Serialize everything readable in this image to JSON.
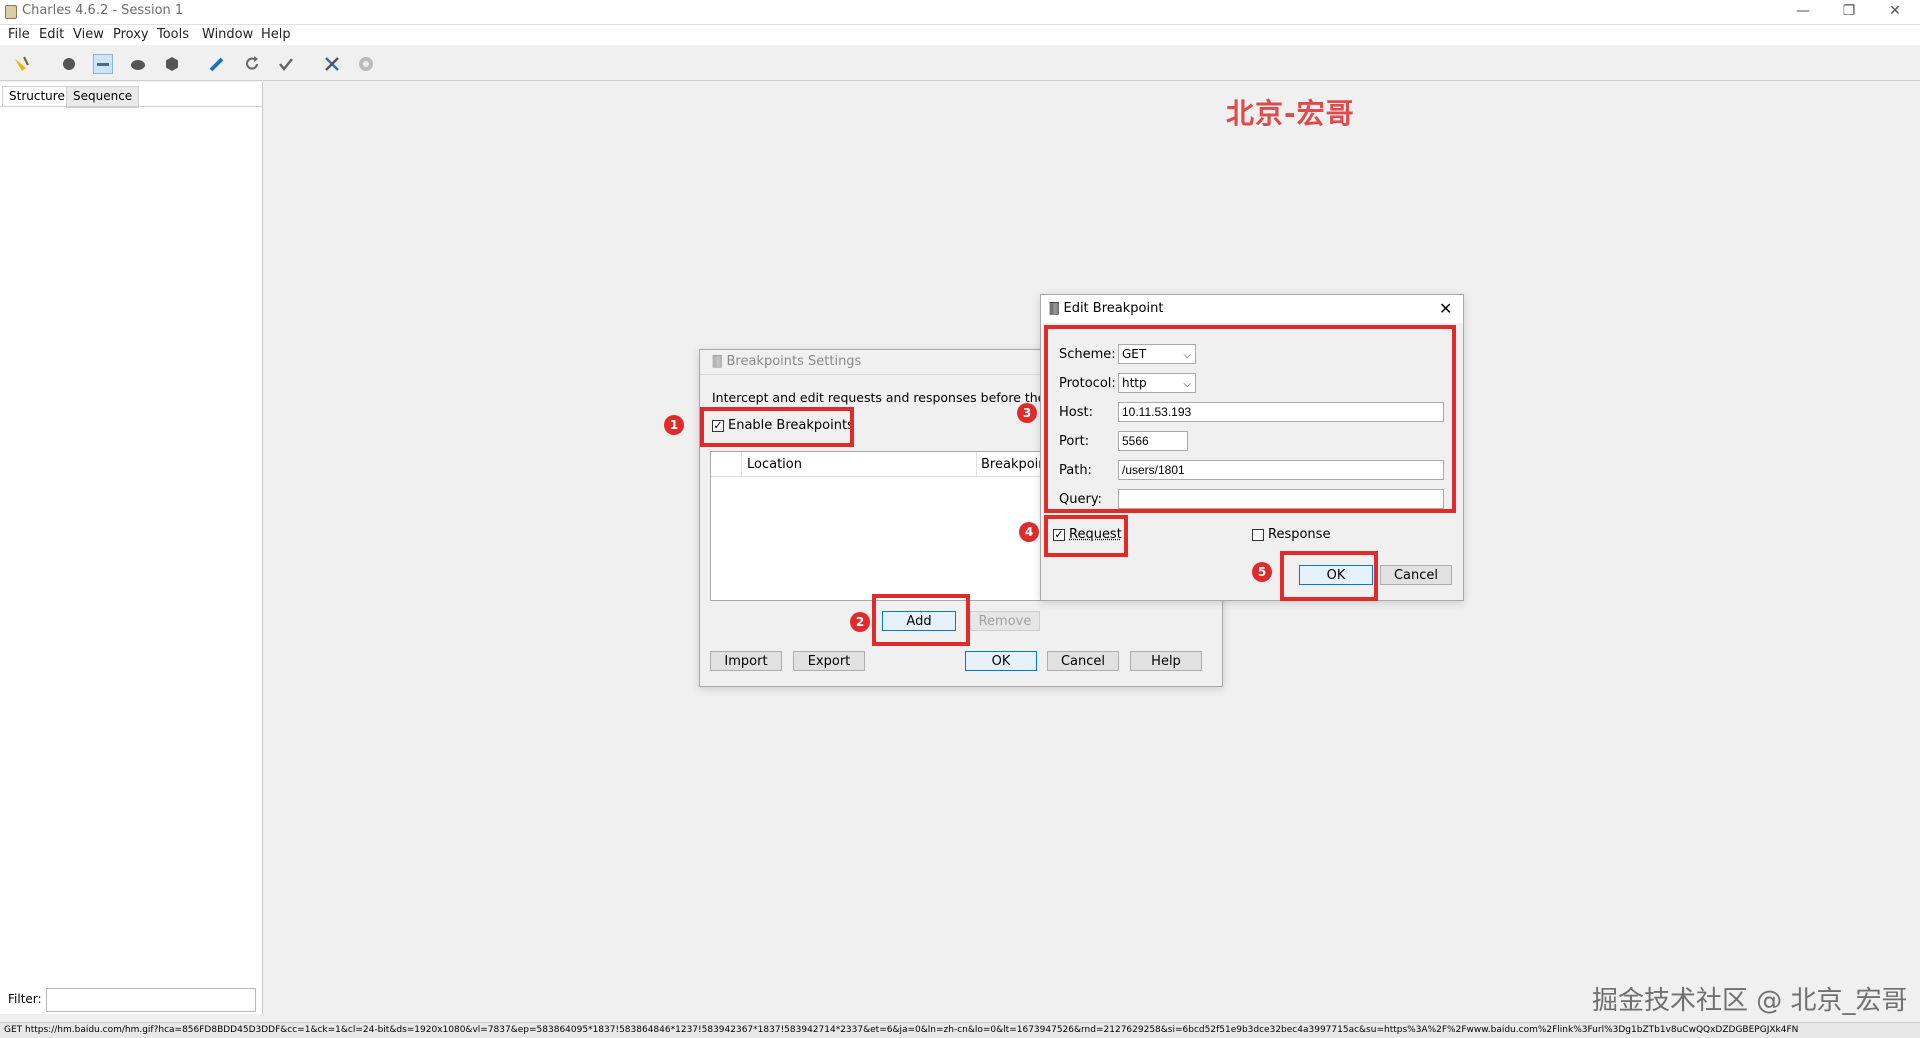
{
  "window": {
    "title": "Charles 4.6.2 - Session 1",
    "minimize": "—",
    "restore": "❐",
    "close": "✕"
  },
  "menu": [
    "File",
    "Edit",
    "View",
    "Proxy",
    "Tools",
    "Window",
    "Help"
  ],
  "toolbar_icons": [
    "broom-icon",
    "record-icon",
    "throttle-icon",
    "turtle-icon",
    "breakpoint-hexagon-icon",
    "pen-icon",
    "refresh-icon",
    "check-icon",
    "tools-icon",
    "settings-gear-icon"
  ],
  "left_panel": {
    "tabs": [
      "Structure",
      "Sequence"
    ],
    "filter_label": "Filter:",
    "filter_value": ""
  },
  "watermarks": {
    "top": "北京-宏哥",
    "bottom": "掘金技术社区 @ 北京_宏哥"
  },
  "status_bar": "GET https://hm.baidu.com/hm.gif?hca=856FD8BDD45D3DDF&cc=1&ck=1&cl=24-bit&ds=1920x1080&vl=7837&ep=583864095*1837!583864846*1237!583942367*1837!583942714*2337&et=6&ja=0&ln=zh-cn&lo=0&lt=1673947526&rnd=2127629258&si=6bcd52f51e9b3dce32bec4a3997715ac&su=https%3A%2F%2Fwww.baidu.com%2Flink%3Furl%3Dg1bZTb1v8uCwQQxDZDGBEPGJXk4FN",
  "breakpoints_settings": {
    "title": "Breakpoints Settings",
    "description": "Intercept and edit requests and responses before they a",
    "enable_label": "Enable Breakpoints",
    "enable_checked": true,
    "columns": [
      "Location",
      "Breakpoin"
    ],
    "buttons": {
      "add": "Add",
      "remove": "Remove",
      "import": "Import",
      "export": "Export",
      "ok": "OK",
      "cancel": "Cancel",
      "help": "Help"
    }
  },
  "edit_breakpoint": {
    "title": "Edit Breakpoint",
    "close": "✕",
    "fields": {
      "scheme_label": "Scheme:",
      "scheme_value": "GET",
      "protocol_label": "Protocol:",
      "protocol_value": "http",
      "host_label": "Host:",
      "host_value": "10.11.53.193",
      "port_label": "Port:",
      "port_value": "5566",
      "path_label": "Path:",
      "path_value": "/users/1801",
      "query_label": "Query:",
      "query_value": ""
    },
    "request_label": "Request",
    "request_checked": true,
    "response_label": "Response",
    "response_checked": false,
    "ok": "OK",
    "cancel": "Cancel"
  },
  "step_badges": [
    "1",
    "2",
    "3",
    "4",
    "5"
  ],
  "colors": {
    "annotation_red": "#e02b2b",
    "watermark_red": "#e04a4a",
    "focus_blue": "#0078d7"
  }
}
